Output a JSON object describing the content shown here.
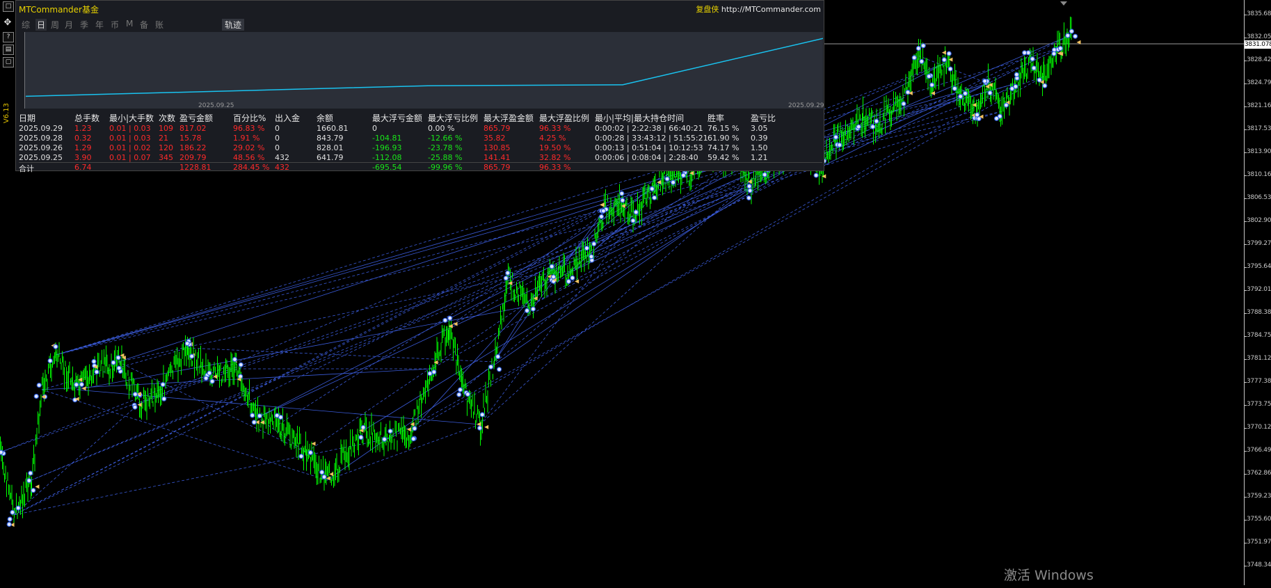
{
  "toolbar": {
    "buttons": [
      "□",
      "✥",
      "?",
      "▤",
      "▢"
    ]
  },
  "version": "V6.13",
  "panel": {
    "brand": "MTCommander基金",
    "url_label": "复盘侠",
    "url": "http://MTCommander.com",
    "tabs": [
      "综",
      "日",
      "周",
      "月",
      "季",
      "年",
      "币",
      "M",
      "备",
      "账户"
    ],
    "active_tab": "日",
    "track_tab": "轨迹",
    "curve": {
      "date_start": "2025.09.25",
      "date_end": "2025.09.29",
      "balance_points": [
        641.79,
        828.01,
        843.79,
        1660.81
      ]
    },
    "table": {
      "headers": [
        "日期",
        "总手数",
        "最小|大手数",
        "次数",
        "盈亏金额",
        "百分比%",
        "出入金",
        "余额",
        "最大浮亏金额",
        "最大浮亏比例",
        "最大浮盈金额",
        "最大浮盈比例",
        "最小|平均|最大持仓时间",
        "胜率",
        "盈亏比"
      ],
      "rows": [
        [
          "2025.09.29",
          "1.23",
          "0.01 | 0.03",
          "109",
          "817.02",
          "96.83 %",
          "0",
          "1660.81",
          "0",
          "0.00 %",
          "865.79",
          "96.33 %",
          "0:00:02 | 2:22:38 | 66:40:21",
          "76.15 %",
          "3.05"
        ],
        [
          "2025.09.28",
          "0.32",
          "0.01 | 0.03",
          "21",
          "15.78",
          "1.91 %",
          "0",
          "843.79",
          "-104.81",
          "-12.66 %",
          "35.82",
          "4.25 %",
          "0:00:28 | 33:43:12 | 51:55:21",
          "61.90 %",
          "0.39"
        ],
        [
          "2025.09.26",
          "1.29",
          "0.01 | 0.02",
          "120",
          "186.22",
          "29.02 %",
          "0",
          "828.01",
          "-196.93",
          "-23.78 %",
          "130.85",
          "19.50 %",
          "0:00:13 | 0:51:04 | 10:12:53",
          "74.17 %",
          "1.50"
        ],
        [
          "2025.09.25",
          "3.90",
          "0.01 | 0.07",
          "345",
          "209.79",
          "48.56 %",
          "432",
          "641.79",
          "-112.08",
          "-25.88 %",
          "141.41",
          "32.82 %",
          "0:00:06 | 0:08:04 | 2:28:40",
          "59.42 %",
          "1.21"
        ]
      ],
      "total": [
        "合计",
        "6.74",
        "",
        "",
        "1228.81",
        "284.45 %",
        "432",
        "",
        "-695.54",
        "-99.96 %",
        "865.79",
        "96.33 %",
        "",
        "",
        ""
      ]
    }
  },
  "price_axis": {
    "labels": [
      "3835.680",
      "3832.050",
      "3828.420",
      "3824.790",
      "3821.160",
      "3817.530",
      "3813.900",
      "3810.160",
      "3806.530",
      "3802.900",
      "3799.270",
      "3795.640",
      "3792.010",
      "3788.380",
      "3784.750",
      "3781.120",
      "3777.380",
      "3773.750",
      "3770.120",
      "3766.490",
      "3762.860",
      "3759.230",
      "3755.600",
      "3751.970",
      "3748.340"
    ],
    "current_price": "3831.078"
  },
  "colors": {
    "candles": "#00ff00",
    "trade_lines": "#3a5bd9",
    "equity_line": "#19c3f0"
  },
  "watermark": "激活 Windows"
}
